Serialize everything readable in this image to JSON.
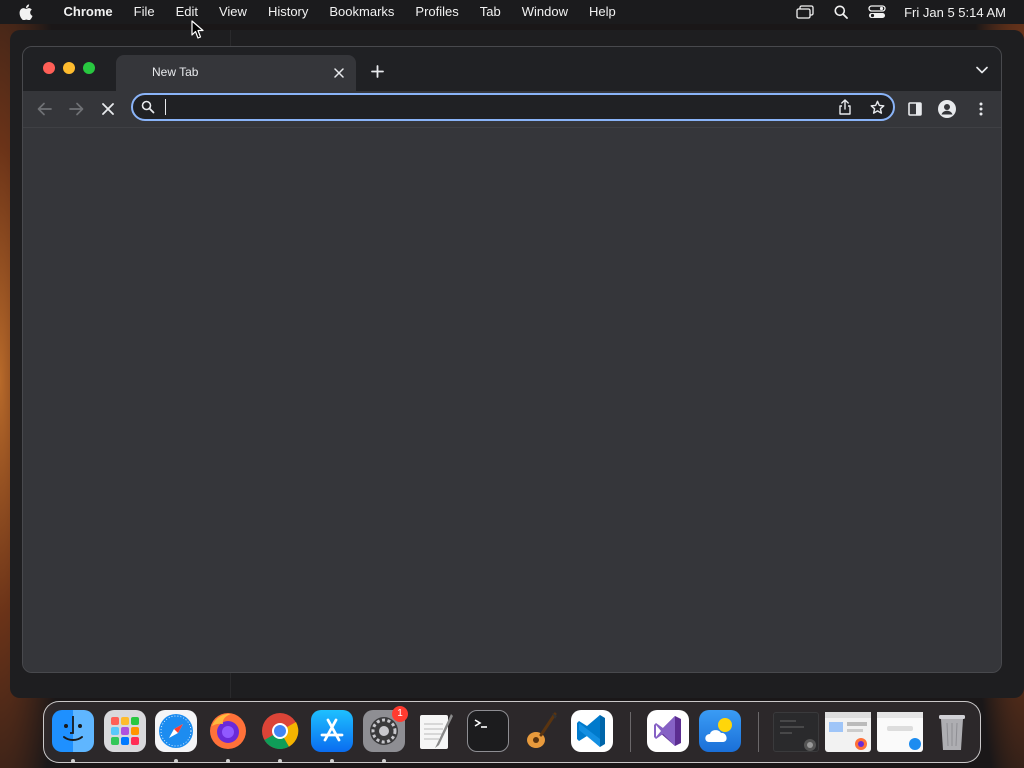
{
  "menubar": {
    "app_name": "Chrome",
    "items": [
      "File",
      "Edit",
      "View",
      "History",
      "Bookmarks",
      "Profiles",
      "Tab",
      "Window",
      "Help"
    ],
    "status_icons": [
      "screen-mirroring-icon",
      "spotlight-search-icon",
      "control-center-icon"
    ],
    "clock": "Fri Jan 5  5:14 AM"
  },
  "browser": {
    "tab": {
      "title": "New Tab"
    },
    "omnibox": {
      "value": "",
      "placeholder": ""
    },
    "toolbar_icons": [
      "back-arrow-icon",
      "forward-arrow-icon",
      "stop-loading-icon",
      "share-icon",
      "bookmark-star-icon",
      "side-panel-icon",
      "profile-icon",
      "more-menu-icon"
    ]
  },
  "dock": {
    "apps": [
      "Finder",
      "Launchpad",
      "Safari",
      "Firefox",
      "Google Chrome",
      "App Store",
      "System Settings",
      "TextEdit",
      "Terminal",
      "GarageBand",
      "Visual Studio Code",
      "Visual Studio",
      "Weather"
    ],
    "system_settings_badge": "1",
    "minimized_windows": 3
  },
  "colors": {
    "menubar_bg": "#1b1b1d",
    "tabstrip_bg": "#202124",
    "toolbar_bg": "#35363a",
    "omnibox_border": "#8ab4f8"
  }
}
